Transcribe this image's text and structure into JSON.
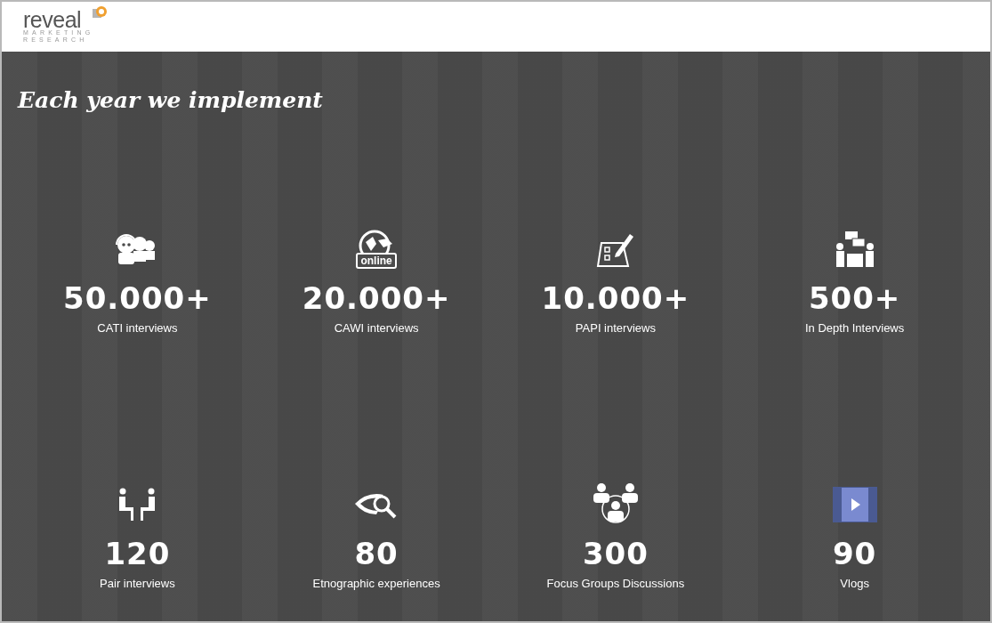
{
  "logo": {
    "name": "reveal",
    "tagline_lines": [
      "MARKETING",
      "RESEARCH"
    ]
  },
  "heading": "Each year we implement",
  "stats": [
    {
      "kind": "call-center",
      "value": "50.000+",
      "label": "CATI interviews"
    },
    {
      "kind": "online",
      "icon_text": "online",
      "value": "20.000+",
      "label": "CAWI interviews"
    },
    {
      "kind": "form",
      "value": "10.000+",
      "label": "PAPI interviews"
    },
    {
      "kind": "meeting",
      "value": "500+",
      "label": "In Depth Interviews"
    },
    {
      "kind": "pair",
      "value": "120",
      "label": "Pair interviews"
    },
    {
      "kind": "eye",
      "value": "80",
      "label": "Etnographic experiences"
    },
    {
      "kind": "group",
      "value": "300",
      "label": "Focus Groups Discussions"
    },
    {
      "kind": "video",
      "value": "90",
      "label": "Vlogs"
    }
  ]
}
